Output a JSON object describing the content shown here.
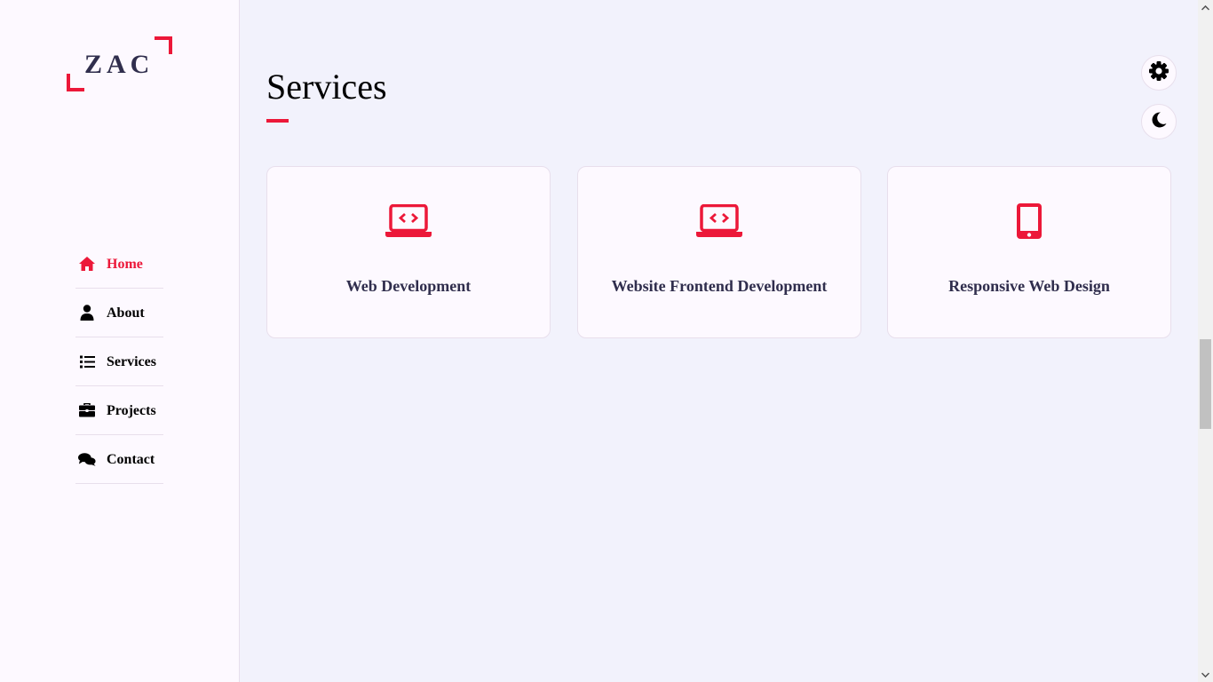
{
  "logo": {
    "text": "ZAC"
  },
  "nav": {
    "items": [
      {
        "label": "Home",
        "icon": "home-icon",
        "active": true
      },
      {
        "label": "About",
        "icon": "user-icon",
        "active": false
      },
      {
        "label": "Services",
        "icon": "list-icon",
        "active": false
      },
      {
        "label": "Projects",
        "icon": "briefcase-icon",
        "active": false
      },
      {
        "label": "Contact",
        "icon": "comments-icon",
        "active": false
      }
    ]
  },
  "main": {
    "title": "Services",
    "cards": [
      {
        "title": "Web Development",
        "icon": "laptop-code-icon"
      },
      {
        "title": "Website Frontend Development",
        "icon": "laptop-code-icon"
      },
      {
        "title": "Responsive Web Design",
        "icon": "mobile-icon"
      }
    ]
  },
  "switcher": {
    "settings_icon": "gear-icon",
    "theme_icon": "moon-icon"
  },
  "colors": {
    "accent": "#ec1839",
    "text_dark": "#302e4d",
    "page_bg": "#f2f2fc",
    "panel_bg": "#fdf9ff",
    "border": "#e8dfec"
  }
}
